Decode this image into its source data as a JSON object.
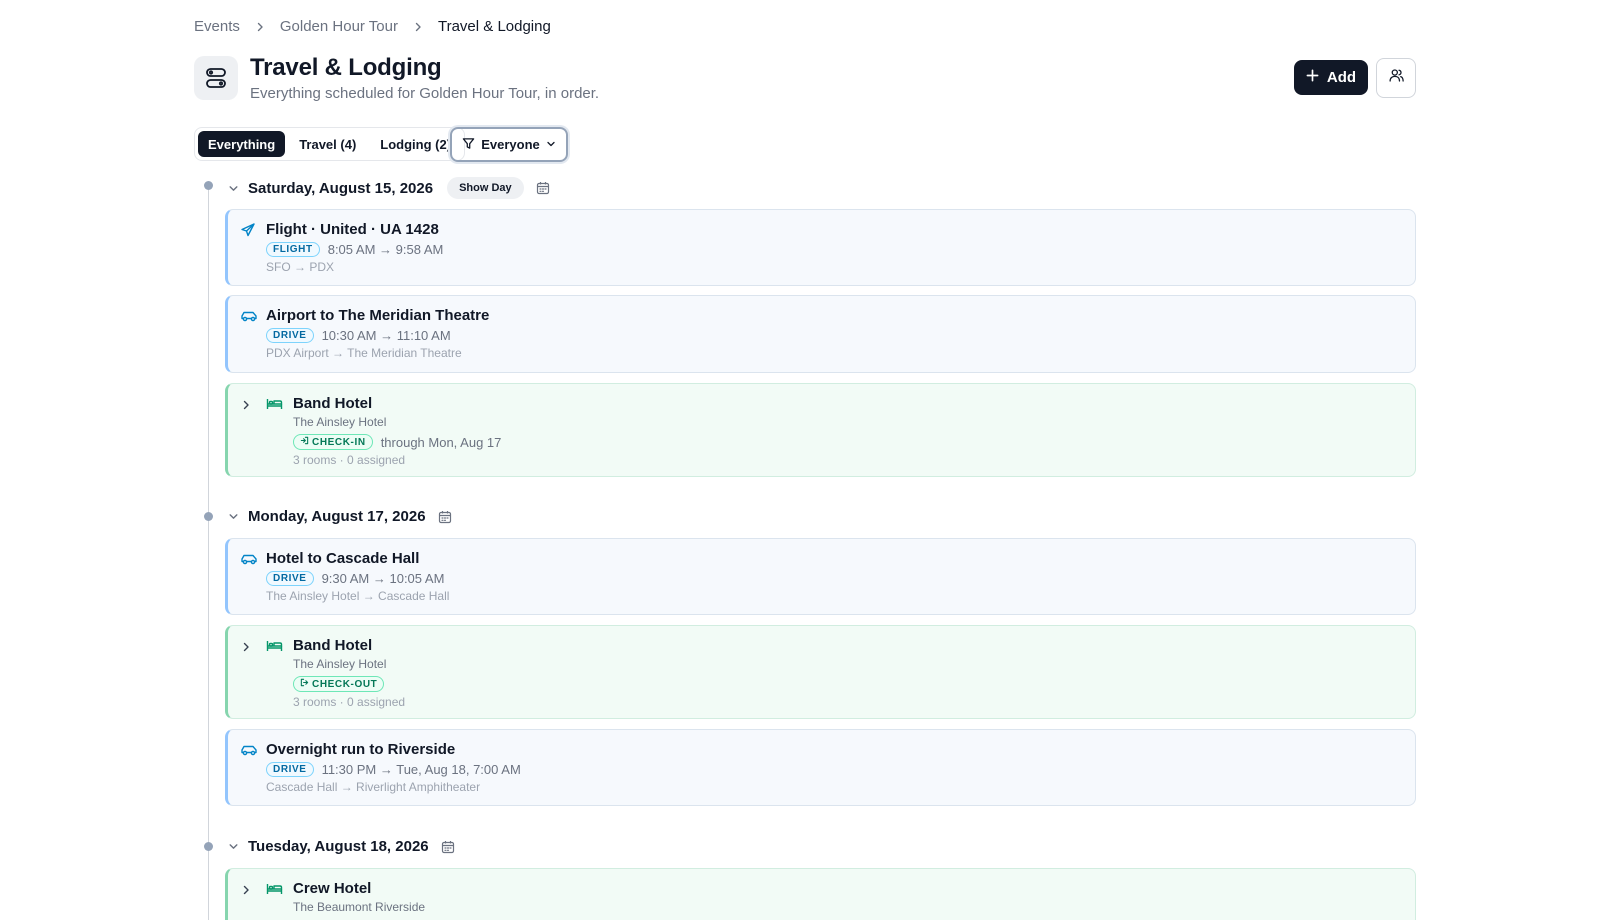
{
  "breadcrumb": {
    "items": [
      "Events",
      "Golden Hour Tour",
      "Travel & Lodging"
    ]
  },
  "header": {
    "title": "Travel & Lodging",
    "subtitle": "Everything scheduled for Golden Hour Tour, in order.",
    "add_label": "Add"
  },
  "tabs": [
    {
      "label": "Everything",
      "active": true
    },
    {
      "label": "Travel (4)",
      "active": false
    },
    {
      "label": "Lodging (2)",
      "active": false
    }
  ],
  "filter": {
    "label": "Everyone"
  },
  "days": [
    {
      "title": "Saturday, August 15, 2026",
      "badge": "Show Day",
      "items": [
        {
          "kind": "travel",
          "icon": "plane-icon",
          "title": "Flight · United · UA 1428",
          "badge": "FLIGHT",
          "time": "8:05 AM → 9:58 AM",
          "route": "SFO → PDX"
        },
        {
          "kind": "travel",
          "icon": "car-icon",
          "title": "Airport to The Meridian Theatre",
          "badge": "DRIVE",
          "time": "10:30 AM → 11:10 AM",
          "route": "PDX Airport → The Meridian Theatre"
        },
        {
          "kind": "lodging",
          "icon": "bed-icon",
          "title": "Band Hotel",
          "hotel": "The Ainsley Hotel",
          "badge": "CHECK-IN",
          "note": "through Mon, Aug 17",
          "rooms": "3 rooms · 0 assigned"
        }
      ]
    },
    {
      "title": "Monday, August 17, 2026",
      "items": [
        {
          "kind": "travel",
          "icon": "car-icon",
          "title": "Hotel to Cascade Hall",
          "badge": "DRIVE",
          "time": "9:30 AM → 10:05 AM",
          "route": "The Ainsley Hotel → Cascade Hall"
        },
        {
          "kind": "lodging",
          "icon": "bed-icon",
          "title": "Band Hotel",
          "hotel": "The Ainsley Hotel",
          "badge": "CHECK-OUT",
          "rooms": "3 rooms · 0 assigned"
        },
        {
          "kind": "travel",
          "icon": "car-icon",
          "title": "Overnight run to Riverside",
          "badge": "DRIVE",
          "time": "11:30 PM → Tue, Aug 18, 7:00 AM",
          "route": "Cascade Hall → Riverlight Amphitheater"
        }
      ]
    },
    {
      "title": "Tuesday, August 18, 2026",
      "items": [
        {
          "kind": "lodging",
          "icon": "bed-icon",
          "title": "Crew Hotel",
          "hotel": "The Beaumont Riverside"
        }
      ]
    }
  ],
  "colors": {
    "primary": "#111827",
    "travel_accent": "#93c5fd",
    "lodging_accent": "#86d5ae",
    "muted_text": "#6b7280"
  }
}
